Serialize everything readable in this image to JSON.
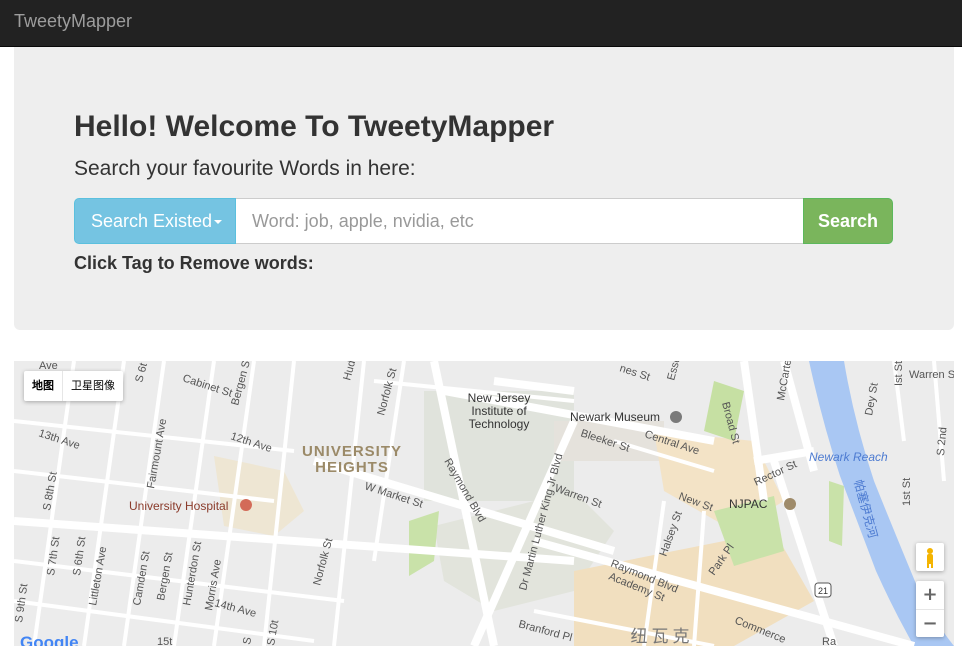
{
  "navbar": {
    "brand": "TweetyMapper"
  },
  "hero": {
    "title": "Hello! Welcome To TweetyMapper",
    "subtitle": "Search your favourite Words in here:",
    "dropdown_label": "Search Existed",
    "input_placeholder": "Word: job, apple, nvidia, etc",
    "input_value": "",
    "search_label": "Search",
    "tag_hint": "Click Tag to Remove words:"
  },
  "map": {
    "type_buttons": [
      "地图",
      "卫星图像"
    ],
    "selected_type": "地图",
    "pois": {
      "njit": [
        "New Jersey",
        "Institute of",
        "Technology"
      ],
      "museum": "Newark Museum",
      "hospital": "University Hospital",
      "njpac": "NJPAC",
      "neighborhood": [
        "UNIVERSITY",
        "HEIGHTS"
      ],
      "newark_reach": "Newark Reach",
      "river": "帕塞伊克河",
      "city": "纽瓦克",
      "route": "21"
    },
    "streets": {
      "s_orange_ave": "Ave",
      "cabinet_st": "Cabinet St",
      "s6": "S 6t",
      "bergen_st_top": "Bergen St",
      "hud": "Hud",
      "norfolk_st_top": "Norfolk St",
      "mlk_top": "nes St",
      "essex": "Esse",
      "broad_top": "",
      "mccarter": "McCarter",
      "warren_top": "Warren S",
      "ist": "Ist St",
      "dey": "Dey St",
      "s2nd": "S 2nd",
      "ave13": "13th Ave",
      "fairmount": "Fairmount Ave",
      "ave12": "12th Ave",
      "s8": "S 8th St",
      "w_market": "W Market St",
      "raymond": "Raymond Blvd",
      "mlk": "Dr Martin Luther King Jr Blvd",
      "warren": "Warren St",
      "bleeker": "Bleeker St",
      "central": "Central Ave",
      "broad": "Broad St",
      "rector": "Rector St",
      "new_st": "New St",
      "halsey": "Halsey St",
      "park_pl": "Park Pl",
      "first": "1st St",
      "raymond2": "Raymond Blvd",
      "academy": "Academy St",
      "commerce": "Commerce",
      "branford": "Branford Pl",
      "s7": "S 7th St",
      "s6b": "S 6th St",
      "littleton": "Littleton Ave",
      "camden": "Camden St",
      "bergen": "Bergen St",
      "hunterdon": "Hunterdon St",
      "morris": "Morris Ave",
      "ave14": "14th Ave",
      "norfolk": "Norfolk St",
      "s9": "S 9th St",
      "s10": "S 10t",
      "st15": "15t",
      "st_s": "S",
      "ra": "Ra"
    },
    "controls": {
      "zoom_in": "+",
      "zoom_out": "−"
    },
    "logo": "Google"
  }
}
